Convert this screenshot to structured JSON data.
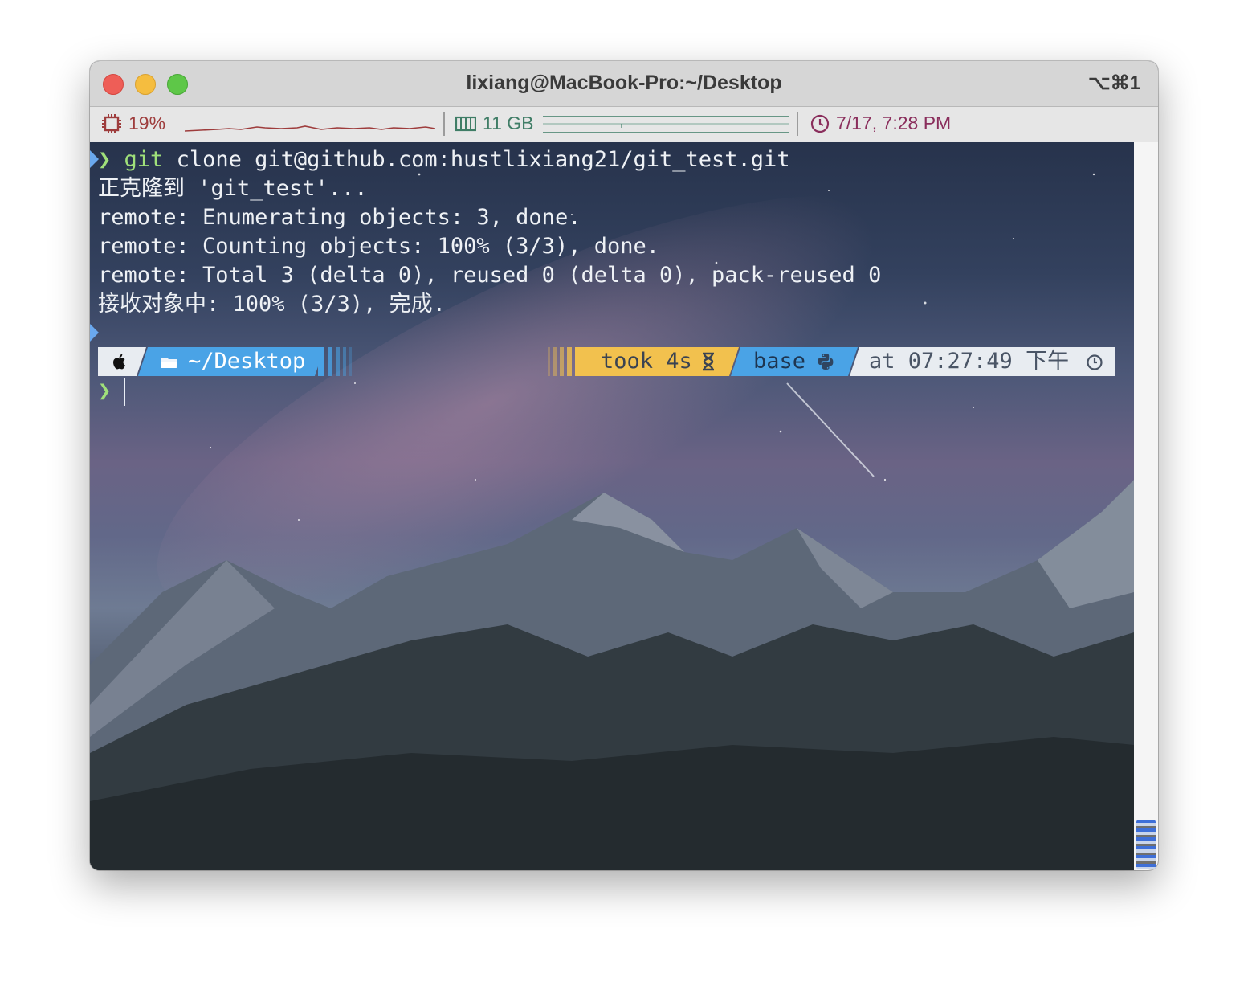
{
  "window": {
    "title": "lixiang@MacBook-Pro:~/Desktop",
    "shortcut": "⌥⌘1"
  },
  "status": {
    "cpu": "19%",
    "memory": "11 GB",
    "datetime": "7/17, 7:28 PM"
  },
  "terminal": {
    "prompt_symbol": "❯",
    "command_name": "git",
    "command_args": " clone git@github.com:hustlixiang21/git_test.git",
    "output": [
      "正克隆到 'git_test'...",
      "remote: Enumerating objects: 3, done.",
      "remote: Counting objects: 100% (3/3), done.",
      "remote: Total 3 (delta 0), reused 0 (delta 0), pack-reused 0",
      "接收对象中: 100% (3/3), 完成."
    ],
    "prompt": {
      "os_icon": "apple-icon",
      "folder_icon": "folder-icon",
      "path": "~/Desktop",
      "took": "took 4s",
      "took_icon": "hourglass-icon",
      "env": "base",
      "env_icon": "python-icon",
      "time": "at 07:27:49 下午",
      "time_icon": "clock-icon"
    }
  },
  "colors": {
    "cpu": "#9e3c3c",
    "memory": "#3f7d66",
    "clock": "#8a2e5c",
    "path_segment": "#4aa3e6",
    "took_segment": "#f2c14e",
    "env_segment": "#4aa3e6",
    "time_segment": "#e8ecf1"
  }
}
